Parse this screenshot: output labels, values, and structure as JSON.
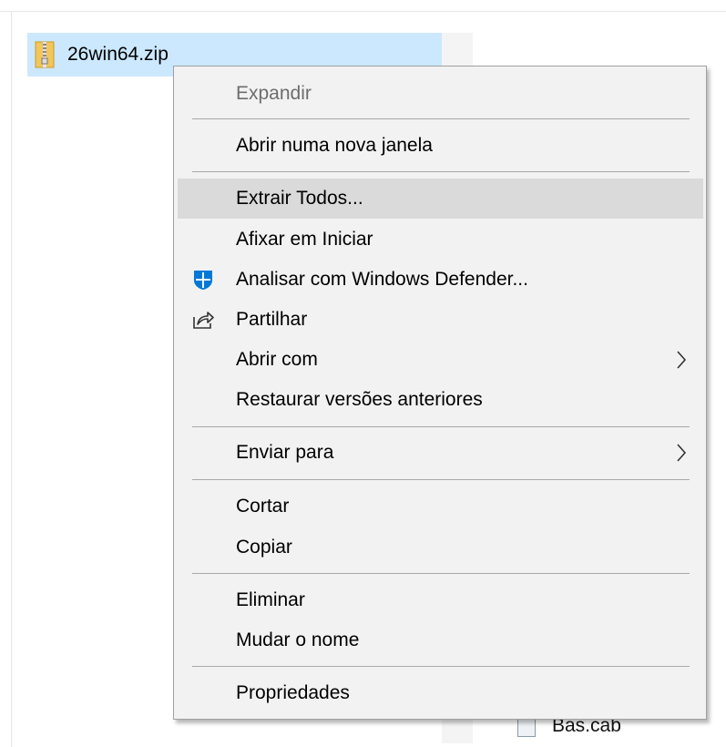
{
  "file": {
    "name": "26win64.zip",
    "icon": "zip-folder-icon"
  },
  "background_file": {
    "name": "Bas.cab",
    "icon": "cab-file-icon"
  },
  "context_menu": {
    "items": [
      {
        "label": "Expandir",
        "enabled": false
      },
      {
        "label": "Abrir numa nova janela"
      },
      {
        "label": "Extrair Todos...",
        "highlighted": true
      },
      {
        "label": "Afixar em Iniciar"
      },
      {
        "label": "Analisar com Windows Defender...",
        "icon": "windows-defender-icon"
      },
      {
        "label": "Partilhar",
        "icon": "share-icon"
      },
      {
        "label": "Abrir com",
        "submenu": true
      },
      {
        "label": "Restaurar versões anteriores"
      },
      {
        "label": "Enviar para",
        "submenu": true
      },
      {
        "label": "Cortar"
      },
      {
        "label": "Copiar"
      },
      {
        "label": "Eliminar"
      },
      {
        "label": "Mudar o nome"
      },
      {
        "label": "Propriedades"
      }
    ]
  },
  "colors": {
    "selection": "#cce8ff",
    "menu_background": "#f2f2f2",
    "menu_hover": "#dadada",
    "defender_blue": "#0078d7"
  }
}
